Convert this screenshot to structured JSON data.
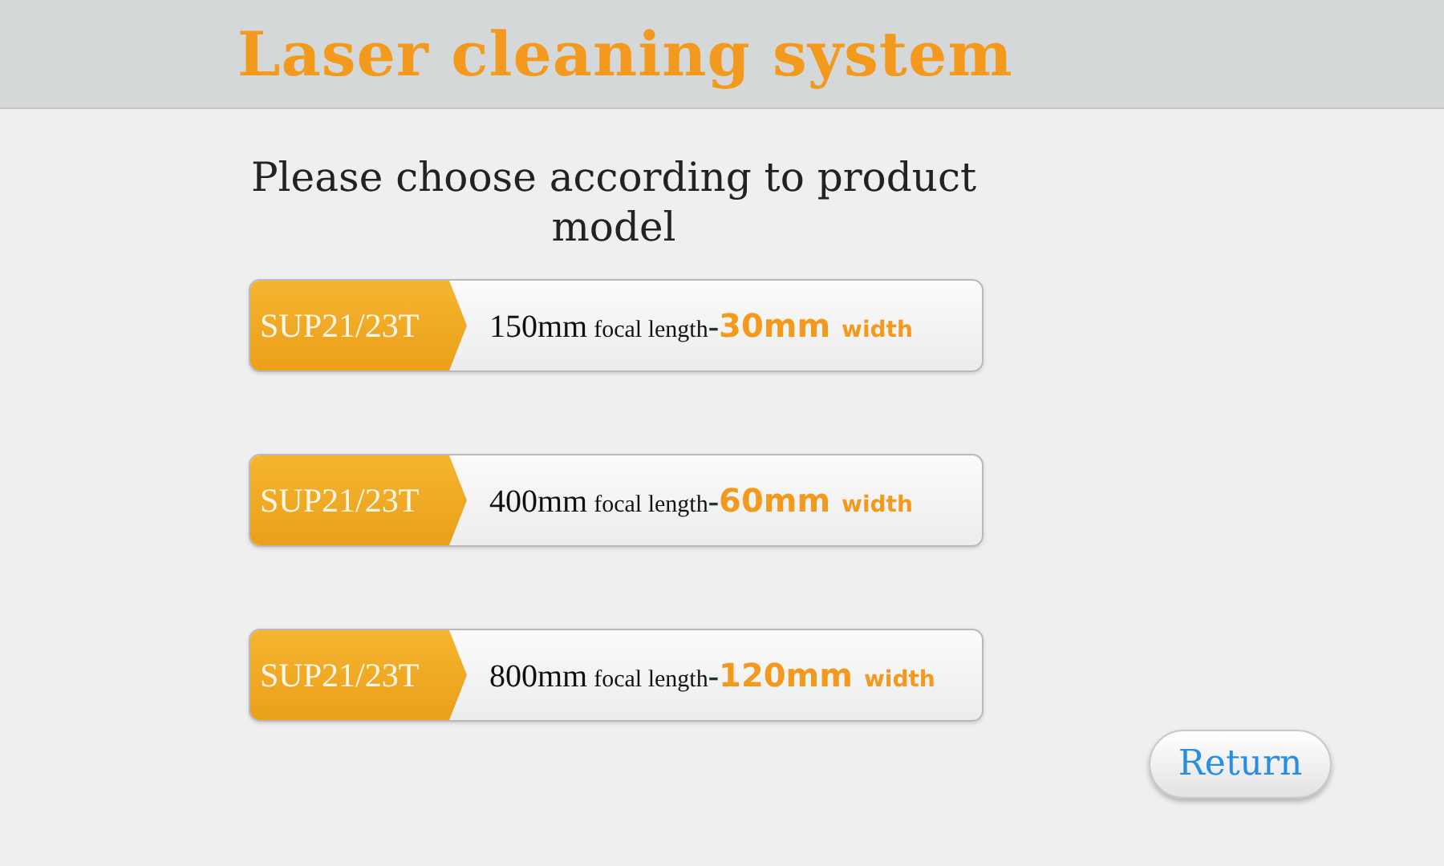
{
  "header": {
    "title": "Laser cleaning system"
  },
  "prompt": "Please choose according to product model",
  "options": [
    {
      "model": "SUP21/23T",
      "focal": "150mm",
      "focal_label": "focal length",
      "dash": "-",
      "width": "30mm",
      "width_label": "width"
    },
    {
      "model": "SUP21/23T",
      "focal": "400mm",
      "focal_label": "focal length",
      "dash": "-",
      "width": "60mm",
      "width_label": "width"
    },
    {
      "model": "SUP21/23T",
      "focal": "800mm",
      "focal_label": "focal length",
      "dash": "-",
      "width": "120mm",
      "width_label": "width"
    }
  ],
  "return_button": "Return"
}
